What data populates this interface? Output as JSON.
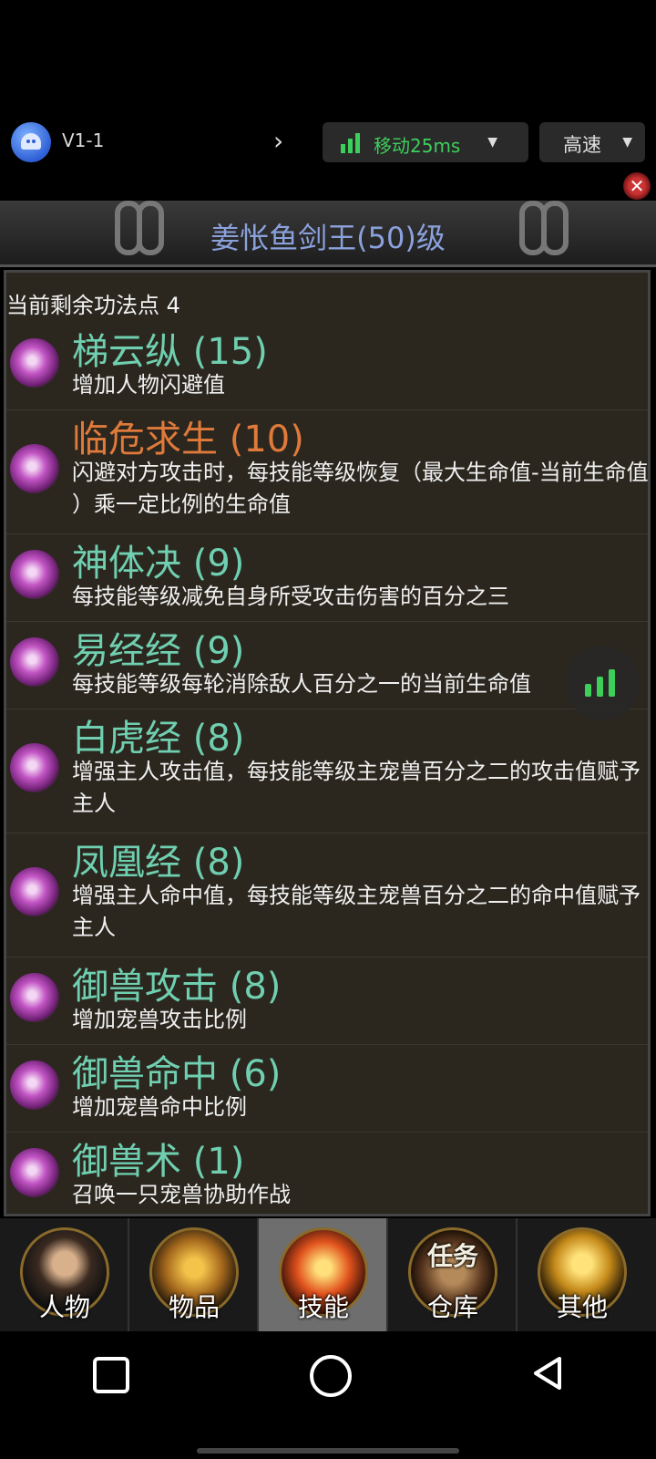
{
  "status": {
    "version": "V1-1",
    "network": "移动25ms",
    "speed": "高速",
    "network_color": "#3ecf5b"
  },
  "window": {
    "title": "姜怅鱼剑王(50)级",
    "points_label": "当前剩余功法点 4"
  },
  "skills": [
    {
      "name": "梯云纵 (15)",
      "desc": "增加人物闪避值",
      "color": "#6fcfb0"
    },
    {
      "name": "临危求生 (10)",
      "desc": "闪避对方攻击时，每技能等级恢复（最大生命值-当前生命值 ）乘一定比例的生命值",
      "color": "#e07a3a"
    },
    {
      "name": "神体决 (9)",
      "desc": "每技能等级减免自身所受攻击伤害的百分之三",
      "color": "#6fcfb0"
    },
    {
      "name": "易经经 (9)",
      "desc": "每技能等级每轮消除敌人百分之一的当前生命值",
      "color": "#6fcfb0"
    },
    {
      "name": "白虎经 (8)",
      "desc": "增强主人攻击值，每技能等级主宠兽百分之二的攻击值赋予主人",
      "color": "#6fcfb0"
    },
    {
      "name": "凤凰经 (8)",
      "desc": "增强主人命中值，每技能等级主宠兽百分之二的命中值赋予主人",
      "color": "#6fcfb0"
    },
    {
      "name": "御兽攻击 (8)",
      "desc": "增加宠兽攻击比例",
      "color": "#6fcfb0"
    },
    {
      "name": "御兽命中 (6)",
      "desc": "增加宠兽命中比例",
      "color": "#6fcfb0"
    },
    {
      "name": "御兽术 (1)",
      "desc": "召唤一只宠兽协助作战",
      "color": "#6fcfb0"
    }
  ],
  "tabs": [
    {
      "label": "人物",
      "icon": "character-portrait-icon"
    },
    {
      "label": "物品",
      "icon": "golden-armor-icon"
    },
    {
      "label": "技能",
      "icon": "flaming-sword-icon"
    },
    {
      "label": "仓库",
      "icon": "treasure-chest-icon",
      "overlay": "任务"
    },
    {
      "label": "其他",
      "icon": "golden-trophy-icon"
    }
  ]
}
